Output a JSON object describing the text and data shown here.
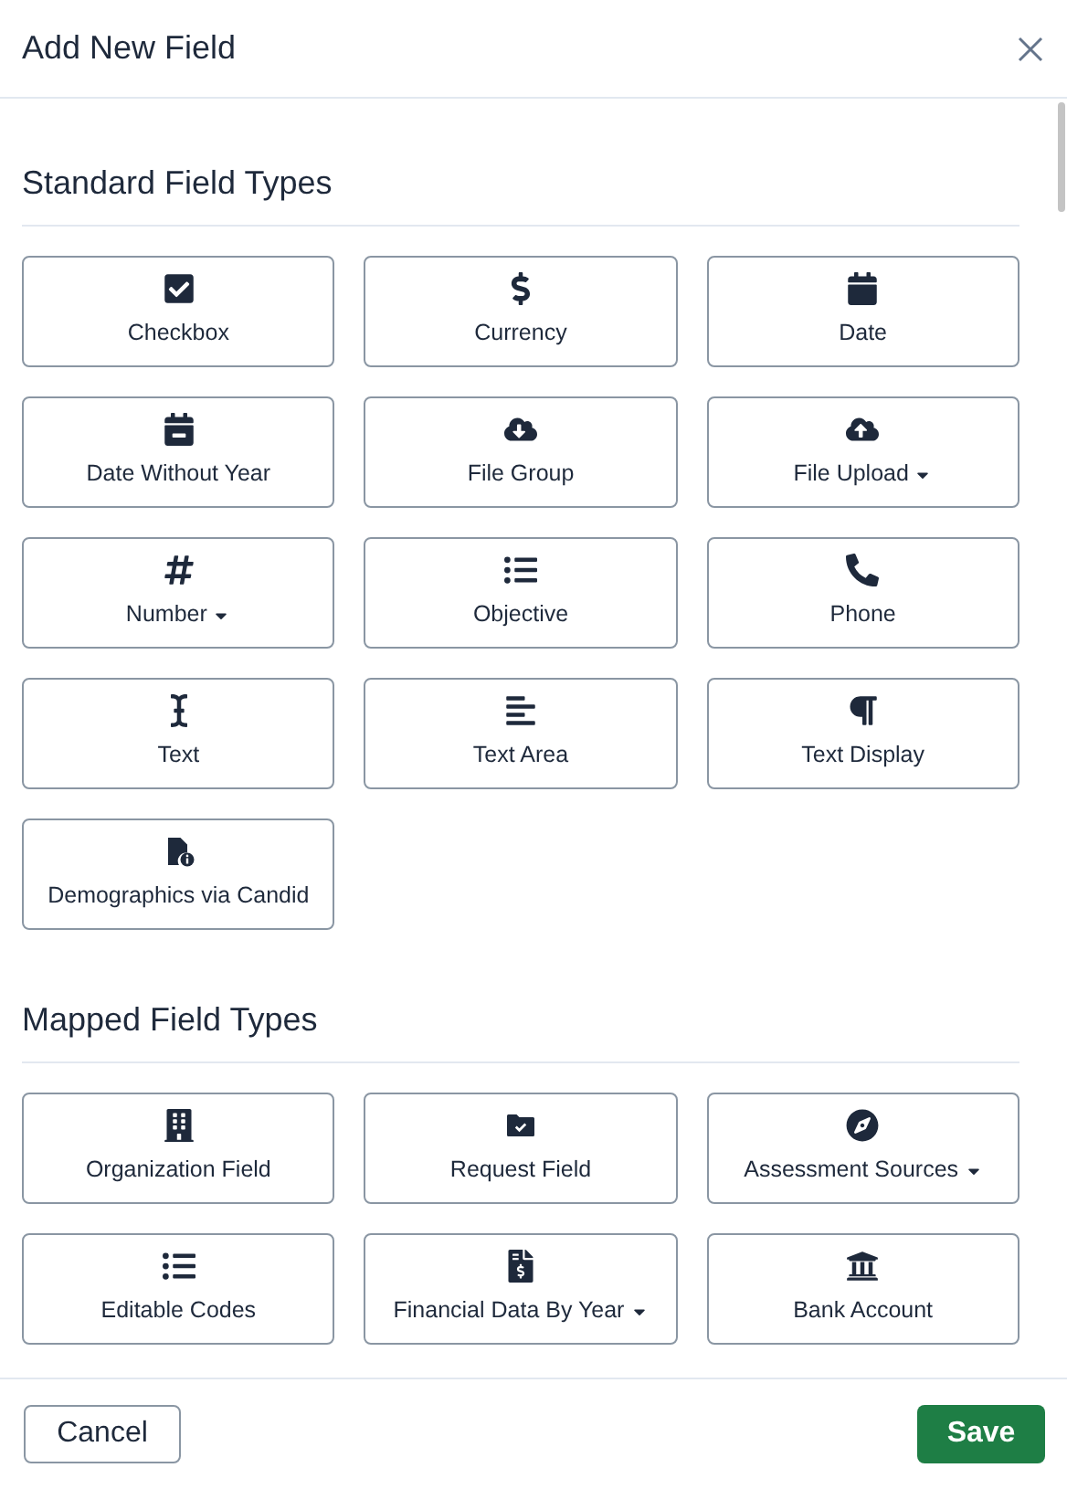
{
  "dialog": {
    "title": "Add New Field"
  },
  "sections": [
    {
      "heading": "Standard Field Types",
      "items": [
        {
          "label": "Checkbox",
          "dropdown": false
        },
        {
          "label": "Currency",
          "dropdown": false
        },
        {
          "label": "Date",
          "dropdown": false
        },
        {
          "label": "Date Without Year",
          "dropdown": false
        },
        {
          "label": "File Group",
          "dropdown": false
        },
        {
          "label": "File Upload",
          "dropdown": true
        },
        {
          "label": "Number",
          "dropdown": true
        },
        {
          "label": "Objective",
          "dropdown": false
        },
        {
          "label": "Phone",
          "dropdown": false
        },
        {
          "label": "Text",
          "dropdown": false
        },
        {
          "label": "Text Area",
          "dropdown": false
        },
        {
          "label": "Text Display",
          "dropdown": false
        },
        {
          "label": "Demographics via Candid",
          "dropdown": false
        }
      ]
    },
    {
      "heading": "Mapped Field Types",
      "items": [
        {
          "label": "Organization Field",
          "dropdown": false
        },
        {
          "label": "Request Field",
          "dropdown": false
        },
        {
          "label": "Assessment Sources",
          "dropdown": true
        },
        {
          "label": "Editable Codes",
          "dropdown": false
        },
        {
          "label": "Financial Data By Year",
          "dropdown": true
        },
        {
          "label": "Bank Account",
          "dropdown": false
        }
      ]
    }
  ],
  "footer": {
    "cancel": "Cancel",
    "save": "Save"
  }
}
